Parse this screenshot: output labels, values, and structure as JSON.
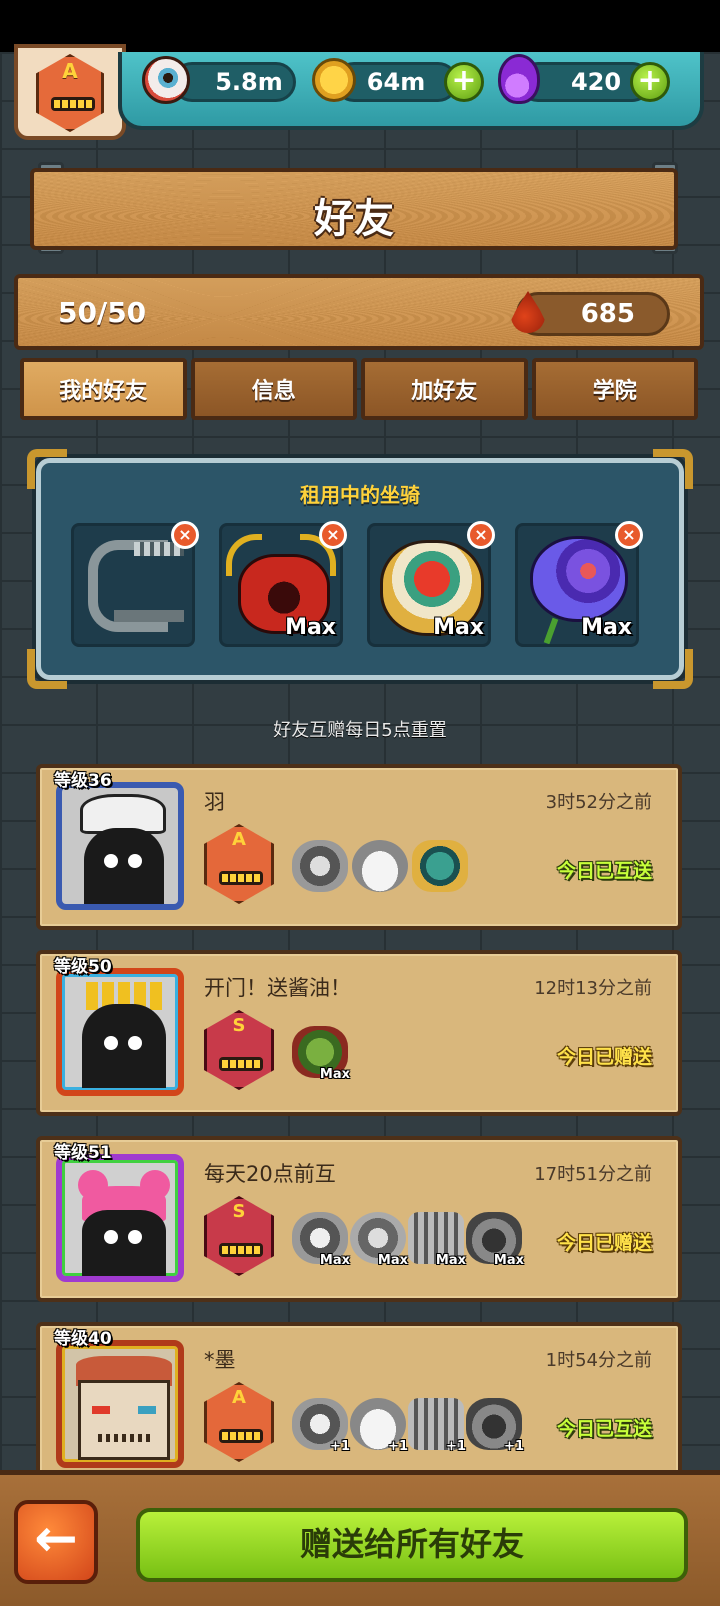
{
  "resources": {
    "eye_amount": "5.8m",
    "coin_amount": "64m",
    "potion_amount": "420",
    "plus_label": "+"
  },
  "profile": {
    "rank_letter": "A"
  },
  "header": {
    "title": "好友"
  },
  "counter": {
    "friends": "50/50",
    "blood": "685"
  },
  "tabs": [
    {
      "label": "我的好友",
      "active": true
    },
    {
      "label": "信息",
      "active": false
    },
    {
      "label": "加好友",
      "active": false
    },
    {
      "label": "学院",
      "active": false
    }
  ],
  "rental": {
    "title": "租用中的坐骑",
    "remove_label": "×",
    "slots": [
      {
        "name": "mechanical-track",
        "max": ""
      },
      {
        "name": "red-horned-beast",
        "max": "Max"
      },
      {
        "name": "lion-dance",
        "max": "Max"
      },
      {
        "name": "purple-rose",
        "max": "Max"
      }
    ]
  },
  "note": "好友互赠每日5点重置",
  "friends": [
    {
      "level": "等级36",
      "name": "羽",
      "time": "3时52分之前",
      "status": "今日已互送",
      "status_color": "green",
      "rank": "A",
      "mounts": [
        {
          "tag": ""
        },
        {
          "tag": ""
        },
        {
          "tag": ""
        }
      ]
    },
    {
      "level": "等级50",
      "name": "开门！送酱油！",
      "time": "12时13分之前",
      "status": "今日已赠送",
      "status_color": "gold",
      "rank": "S",
      "mounts": [
        {
          "tag": "Max"
        }
      ]
    },
    {
      "level": "等级51",
      "name": "每天20点前互",
      "time": "17时51分之前",
      "status": "今日已赠送",
      "status_color": "gold",
      "rank": "S",
      "mounts": [
        {
          "tag": "Max"
        },
        {
          "tag": "Max"
        },
        {
          "tag": "Max"
        },
        {
          "tag": "Max"
        }
      ]
    },
    {
      "level": "等级40",
      "name": "*墨",
      "time": "1时54分之前",
      "status": "今日已互送",
      "status_color": "green",
      "rank": "A",
      "mounts": [
        {
          "tag": "+1"
        },
        {
          "tag": "+1"
        },
        {
          "tag": "+1"
        },
        {
          "tag": "+1"
        }
      ]
    }
  ],
  "footer": {
    "back_icon": "←",
    "gift_all_label": "赠送给所有好友"
  }
}
